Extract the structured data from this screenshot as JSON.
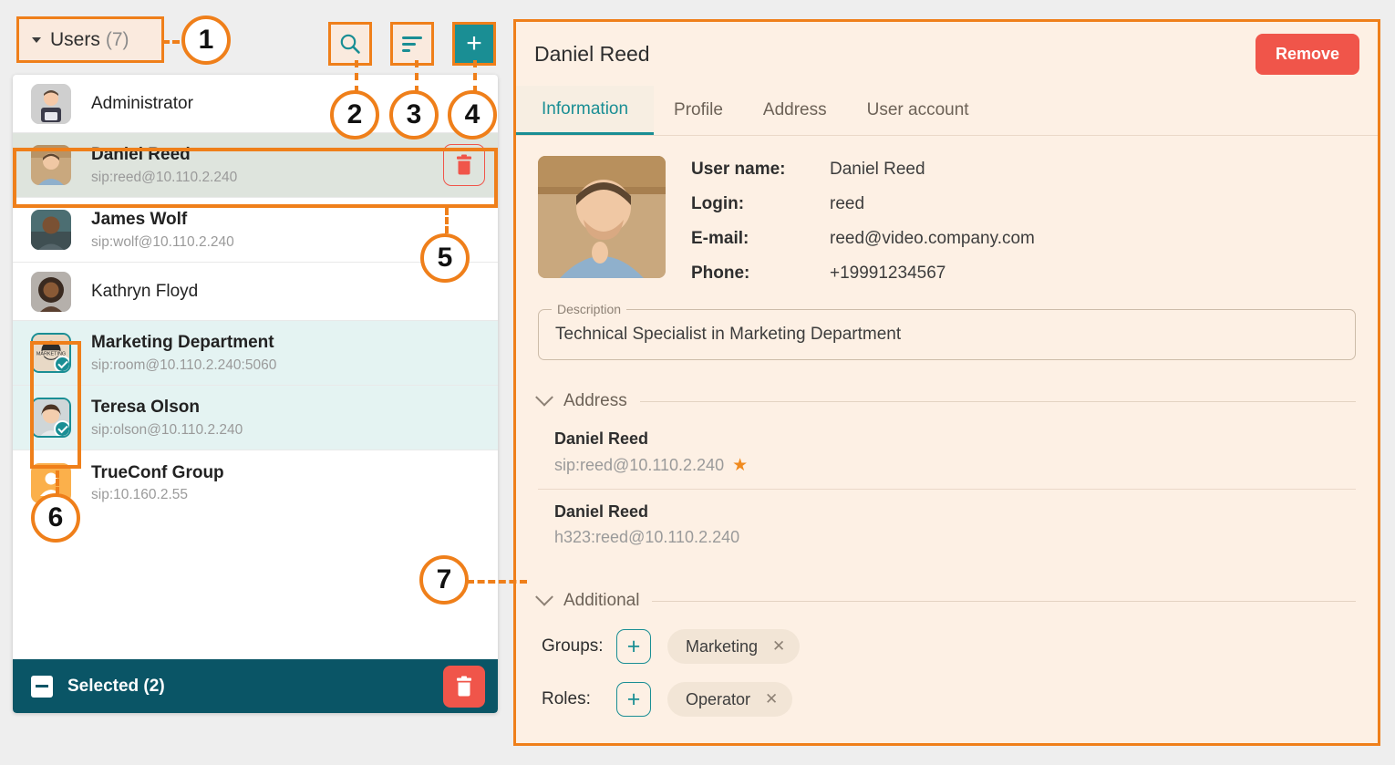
{
  "left_panel": {
    "header": {
      "dropdown_label": "Users",
      "dropdown_count": "(7)",
      "search_icon": "search-icon",
      "sort_icon": "sort-icon",
      "add_icon": "plus-icon"
    },
    "rows": [
      {
        "name": "Administrator",
        "uri": "",
        "state": "normal",
        "avatar_kind": "admin"
      },
      {
        "name": "Daniel Reed",
        "uri": "sip:reed@10.110.2.240",
        "state": "active",
        "avatar_kind": "photo-reed",
        "has_delete": true
      },
      {
        "name": "James Wolf",
        "uri": "sip:wolf@10.110.2.240",
        "state": "normal",
        "avatar_kind": "photo-wolf"
      },
      {
        "name": "Kathryn Floyd",
        "uri": "",
        "state": "normal",
        "avatar_kind": "photo-floyd"
      },
      {
        "name": "Marketing Department",
        "uri": "sip:room@10.110.2.240:5060",
        "state": "checked",
        "avatar_kind": "marketing"
      },
      {
        "name": "Teresa Olson",
        "uri": "sip:olson@10.110.2.240",
        "state": "checked",
        "avatar_kind": "photo-olson"
      },
      {
        "name": "TrueConf Group",
        "uri": "sip:10.160.2.55",
        "state": "normal",
        "avatar_kind": "group"
      }
    ],
    "selected_bar": {
      "label": "Selected (2)",
      "minus_icon": "minus-checkbox-icon",
      "delete_icon": "trash-icon"
    }
  },
  "right_panel": {
    "title": "Daniel Reed",
    "remove_label": "Remove",
    "tabs": [
      {
        "label": "Information",
        "active": true
      },
      {
        "label": "Profile",
        "active": false
      },
      {
        "label": "Address",
        "active": false
      },
      {
        "label": "User account",
        "active": false
      }
    ],
    "fields": [
      {
        "label": "User name:",
        "value": "Daniel Reed"
      },
      {
        "label": "Login:",
        "value": "reed"
      },
      {
        "label": "E-mail:",
        "value": "reed@video.company.com"
      },
      {
        "label": "Phone:",
        "value": "+19991234567"
      }
    ],
    "description": {
      "legend": "Description",
      "value": "Technical Specialist in Marketing Department"
    },
    "address_section": {
      "title": "Address",
      "items": [
        {
          "name": "Daniel Reed",
          "uri": "sip:reed@10.110.2.240",
          "starred": true,
          "star": "★"
        },
        {
          "name": "Daniel Reed",
          "uri": "h323:reed@10.110.2.240",
          "starred": false,
          "star": ""
        }
      ]
    },
    "additional_section": {
      "title": "Additional",
      "rows": [
        {
          "label": "Groups:",
          "add_icon": "plus-icon",
          "chip": "Marketing",
          "chip_close": "✕"
        },
        {
          "label": "Roles:",
          "add_icon": "plus-icon",
          "chip": "Operator",
          "chip_close": "✕"
        }
      ]
    }
  },
  "callouts": [
    {
      "number": "1"
    },
    {
      "number": "2"
    },
    {
      "number": "3"
    },
    {
      "number": "4"
    },
    {
      "number": "5"
    },
    {
      "number": "6"
    },
    {
      "number": "7"
    }
  ],
  "colors": {
    "accent_orange": "#ef7f1a",
    "teal": "#1a8e94",
    "red": "#f0554a",
    "dark_teal_bar": "#0a5566",
    "panel_cream": "#fdf0e4",
    "selected_row_teal": "#e4f3f2",
    "active_row_grey": "#dee4dd"
  }
}
